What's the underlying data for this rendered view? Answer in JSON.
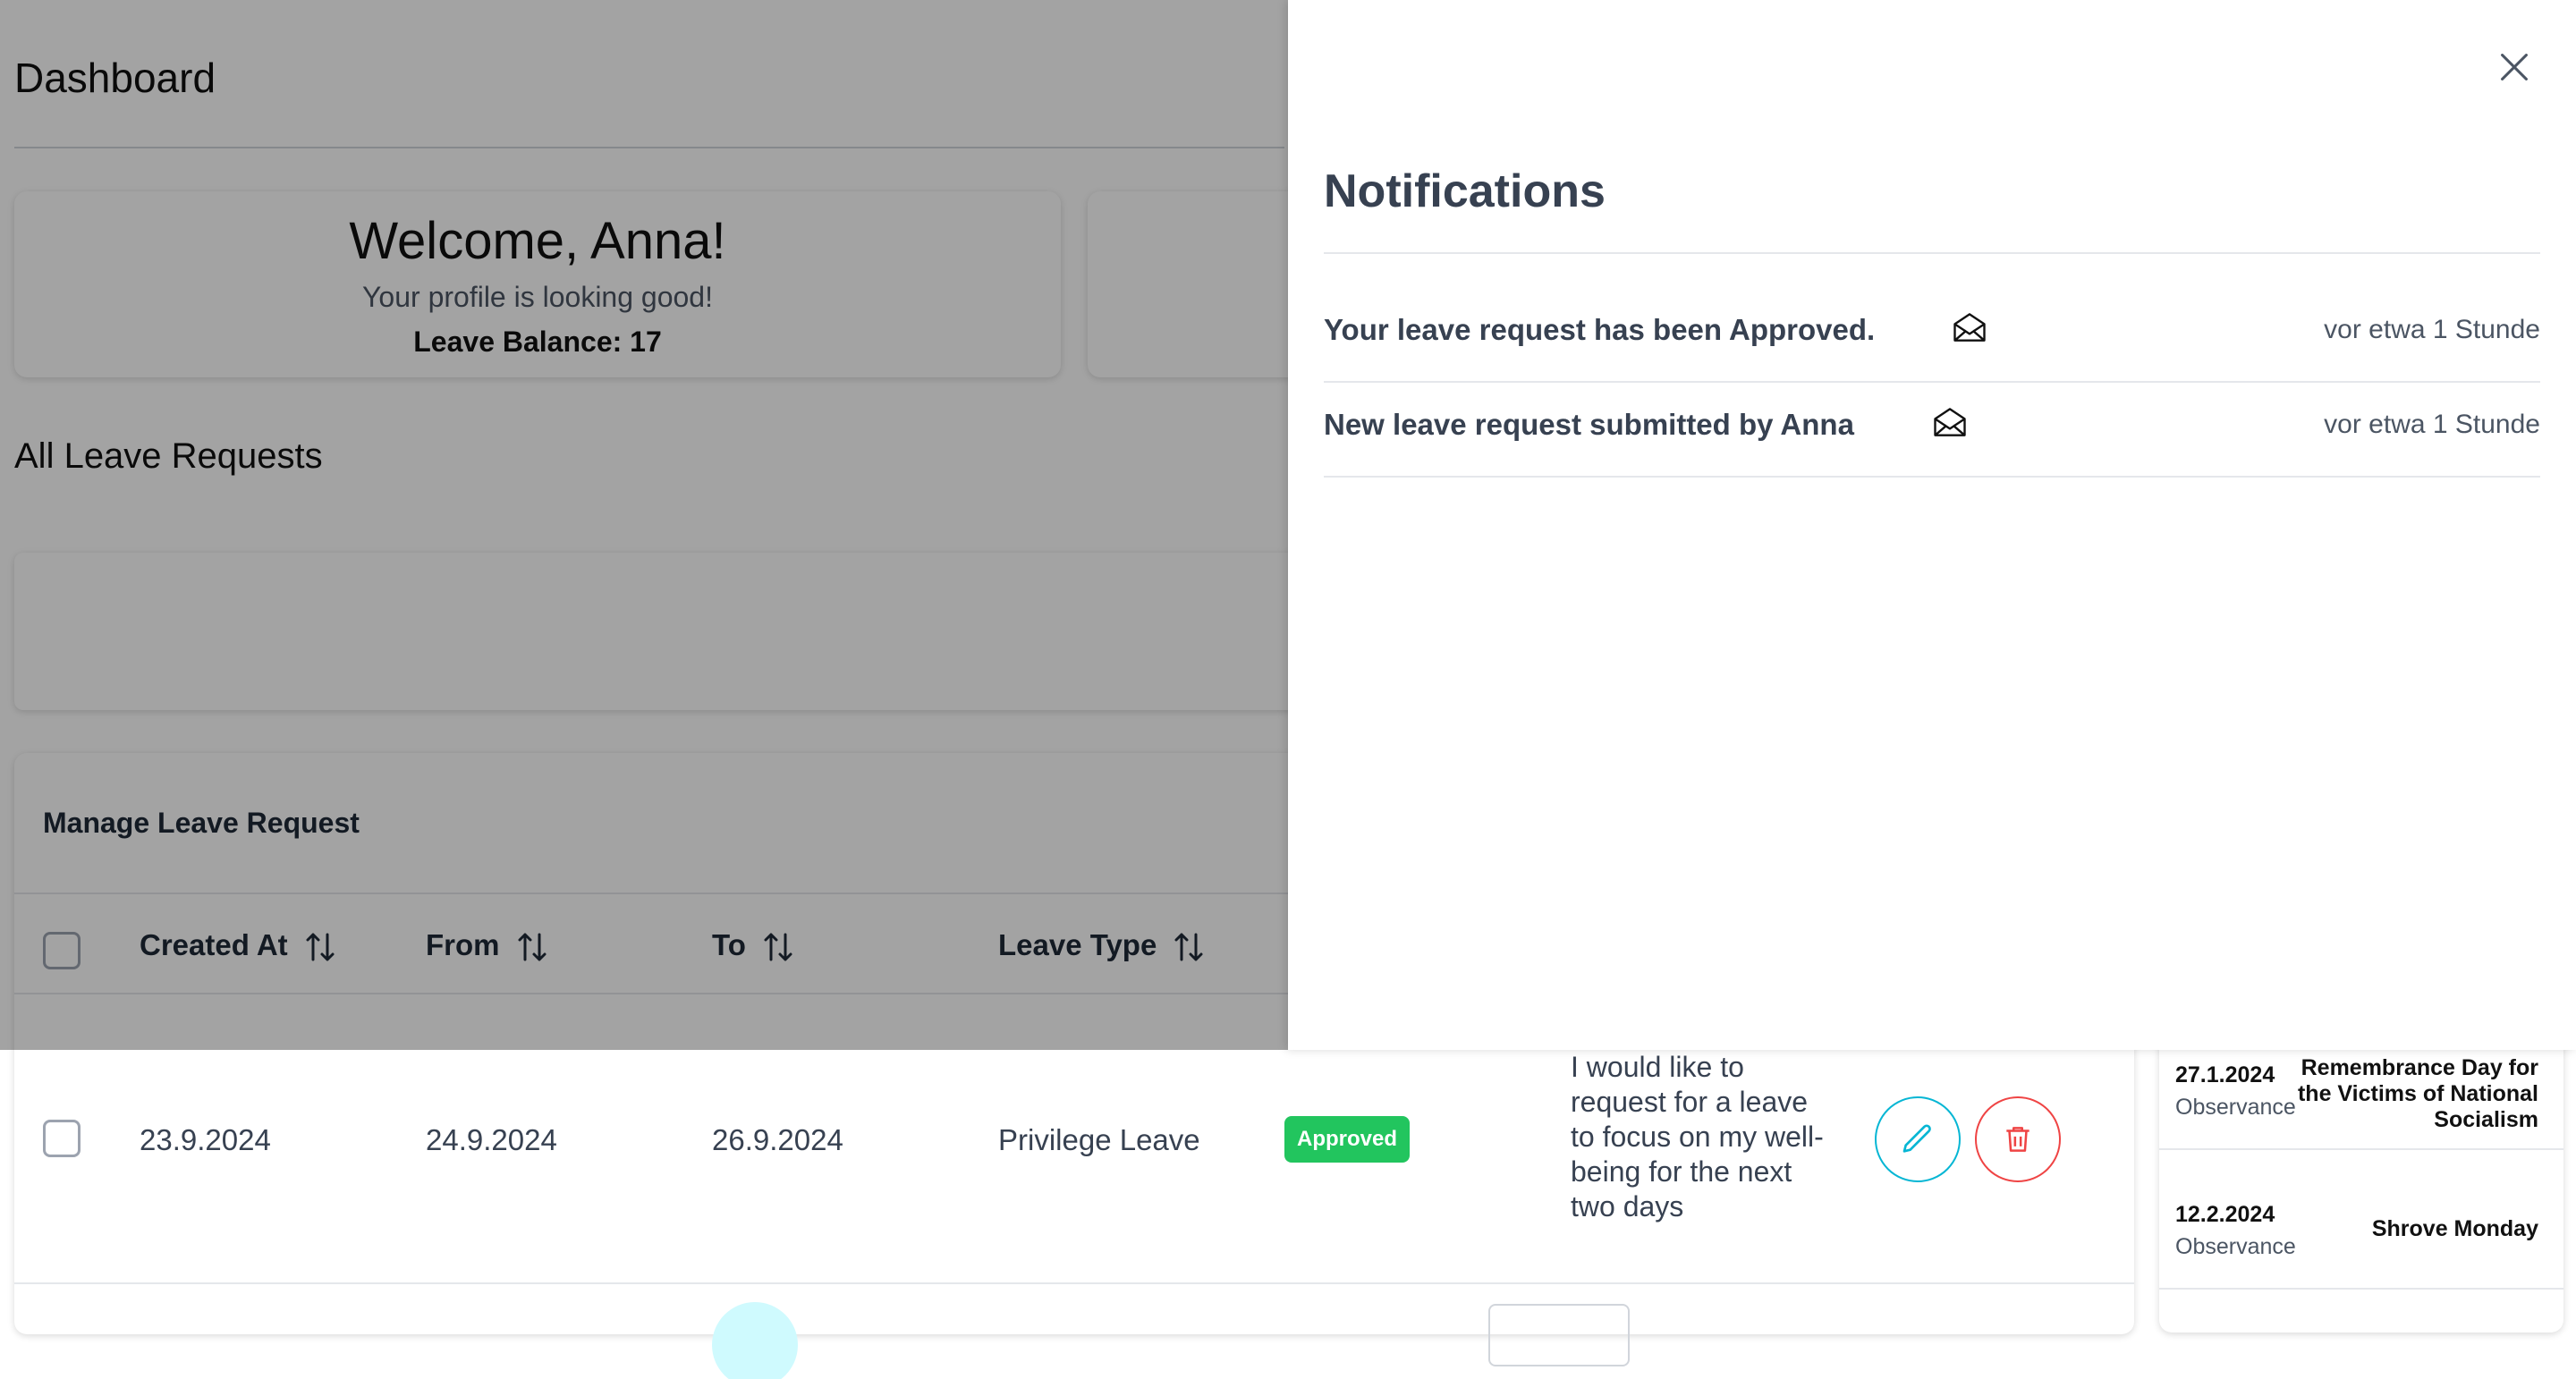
{
  "page": {
    "title": "Dashboard"
  },
  "welcome": {
    "title": "Welcome, Anna!",
    "subtitle": "Your profile is looking good!",
    "leave_balance": "Leave Balance: 17"
  },
  "section_title": "All Leave Requests",
  "table": {
    "title": "Manage Leave Request",
    "columns": [
      "Created At",
      "From",
      "To",
      "Leave Type"
    ],
    "rows": [
      {
        "created_at": "23.9.2024",
        "from": "24.9.2024",
        "to": "26.9.2024",
        "leave_type": "Privilege Leave",
        "status": "Approved",
        "reason": "I would like to request for a leave to focus on my well-being for the next two days"
      }
    ],
    "status_color": "#22c55e"
  },
  "holidays": [
    {
      "date": "27.1.2024",
      "kind": "Observance",
      "name": "Remembrance Day for the Victims of National Socialism"
    },
    {
      "date": "12.2.2024",
      "kind": "Observance",
      "name": "Shrove Monday"
    }
  ],
  "notifications": {
    "title": "Notifications",
    "close_icon": "close-icon",
    "items": [
      {
        "message": "Your leave request has been Approved.",
        "icon": "envelope-open-icon",
        "time": "vor etwa 1 Stunde"
      },
      {
        "message": "New leave request submitted by Anna",
        "icon": "envelope-open-icon",
        "time": "vor etwa 1 Stunde"
      }
    ]
  },
  "colors": {
    "edit": "#06b6d4",
    "delete": "#ef4444",
    "overlay": "rgba(0,0,0,0.36)"
  }
}
